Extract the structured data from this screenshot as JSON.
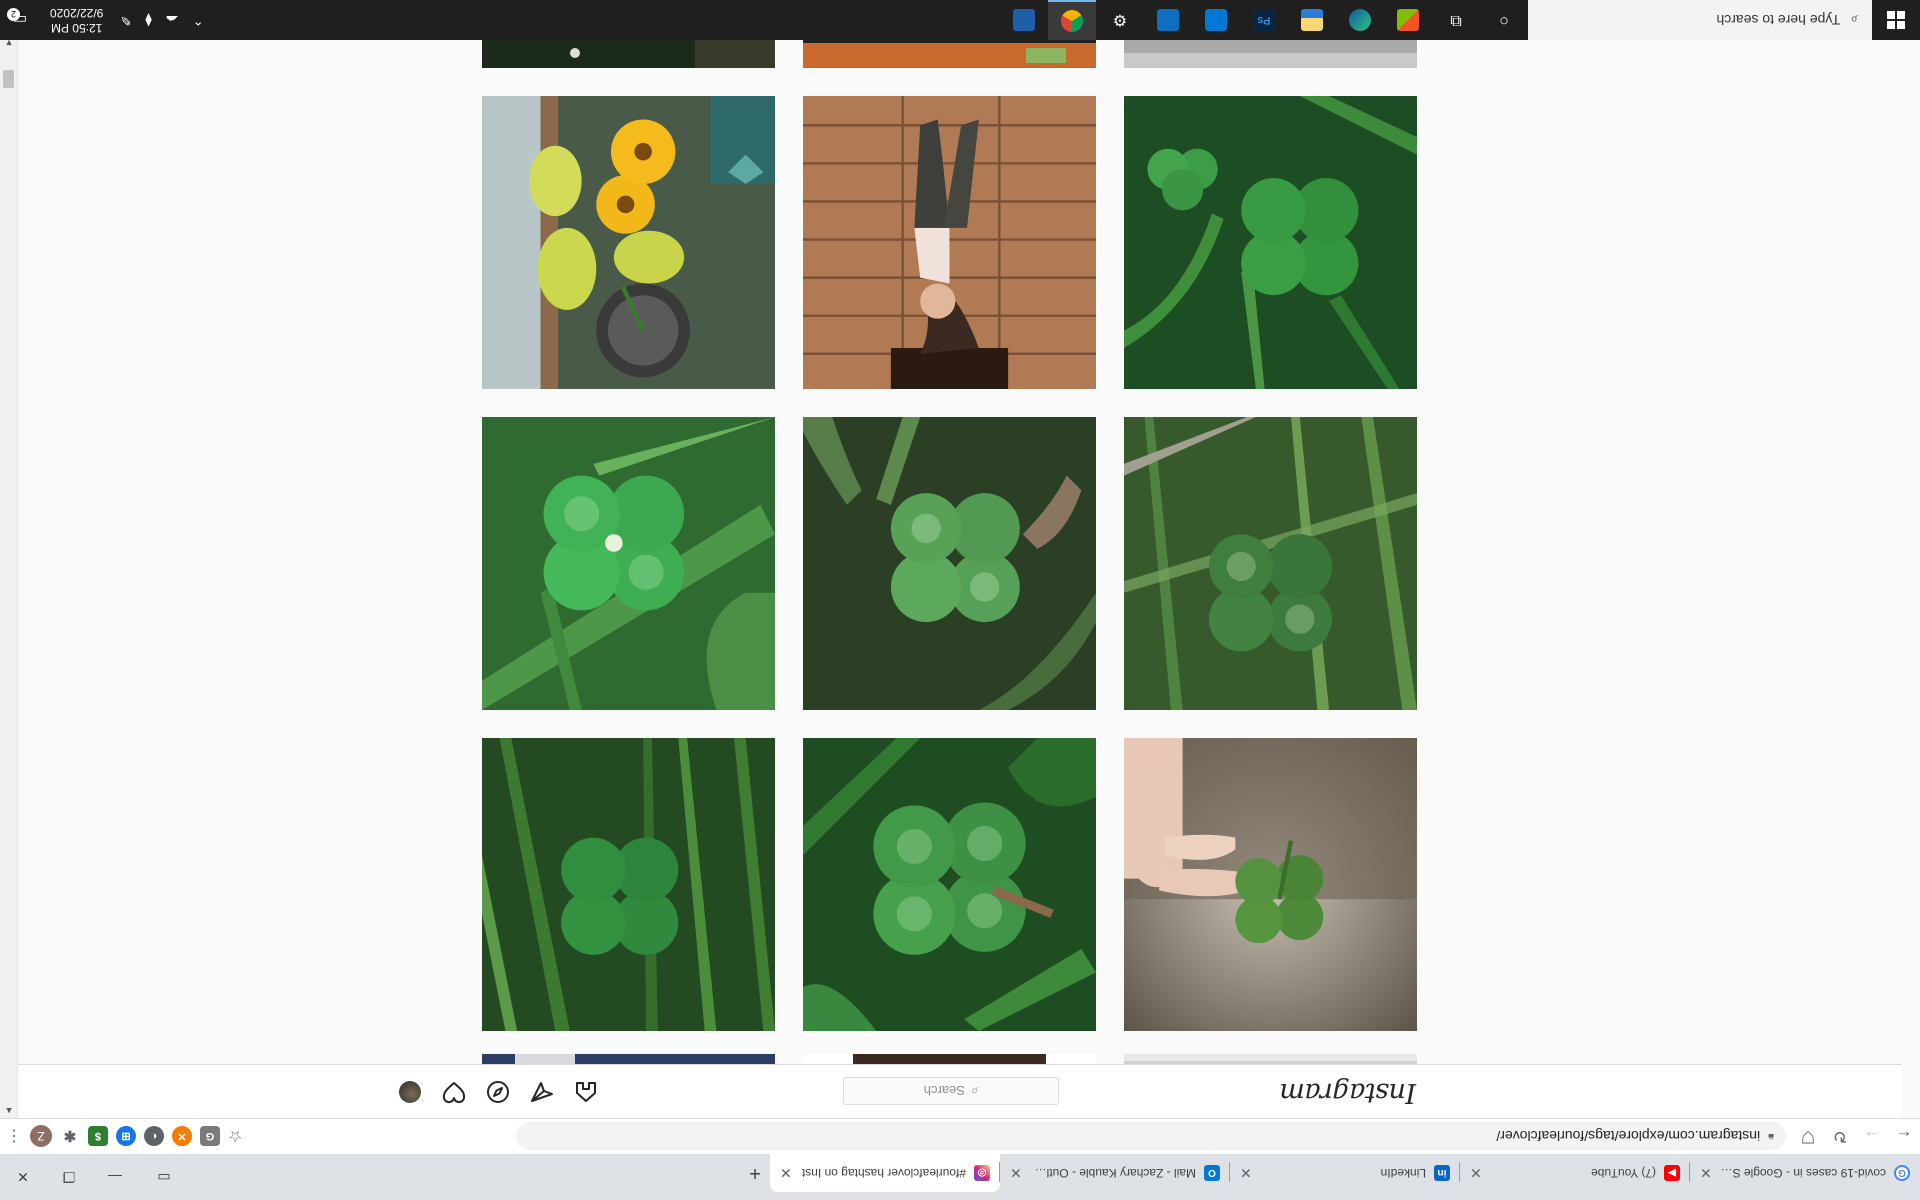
{
  "browser": {
    "tabs": [
      {
        "title": "covid-19 cases in - Google Sear",
        "favicon": "google-icon",
        "color": "#4285f4",
        "active": false
      },
      {
        "title": "(7) YouTube",
        "favicon": "youtube-icon",
        "color": "#ff0000",
        "active": false
      },
      {
        "title": "LinkedIn",
        "favicon": "linkedin-icon",
        "color": "#0a66c2",
        "active": false
      },
      {
        "title": "Mail - Zachary Kauble - Outlook",
        "favicon": "outlook-icon",
        "color": "#0078d4",
        "active": false
      },
      {
        "title": "#fourleafclover hashtag on Inst",
        "favicon": "instagram-icon",
        "color": "#d62976",
        "active": true
      }
    ],
    "new_tab": "+",
    "address": {
      "url": "instagram.com/explore/tags/fourleafclover/"
    },
    "profile_initial": "Z"
  },
  "instagram": {
    "logo": "Instagram",
    "search_placeholder": "Search"
  },
  "grid": {
    "rows": [
      [
        "partial-photo",
        "partial-photo",
        "partial-photo"
      ],
      [
        "four-leaf-clover-held-in-fingers",
        "four-leaf-clover-closeup",
        "clover-in-grass"
      ],
      [
        "clover-in-grass",
        "four-leaf-clover-in-weeds",
        "four-leaf-clover-with-grass"
      ],
      [
        "clover-patch",
        "woman-lying-on-wooden-bridge",
        "potted-plant-with-yellow-flowers"
      ],
      [
        "partial-photo",
        "partial-photo",
        "partial-photo"
      ]
    ]
  },
  "taskbar": {
    "search_placeholder": "Type here to search",
    "time": "12:50 PM",
    "date": "9/22/2020",
    "notification_count": "2"
  }
}
